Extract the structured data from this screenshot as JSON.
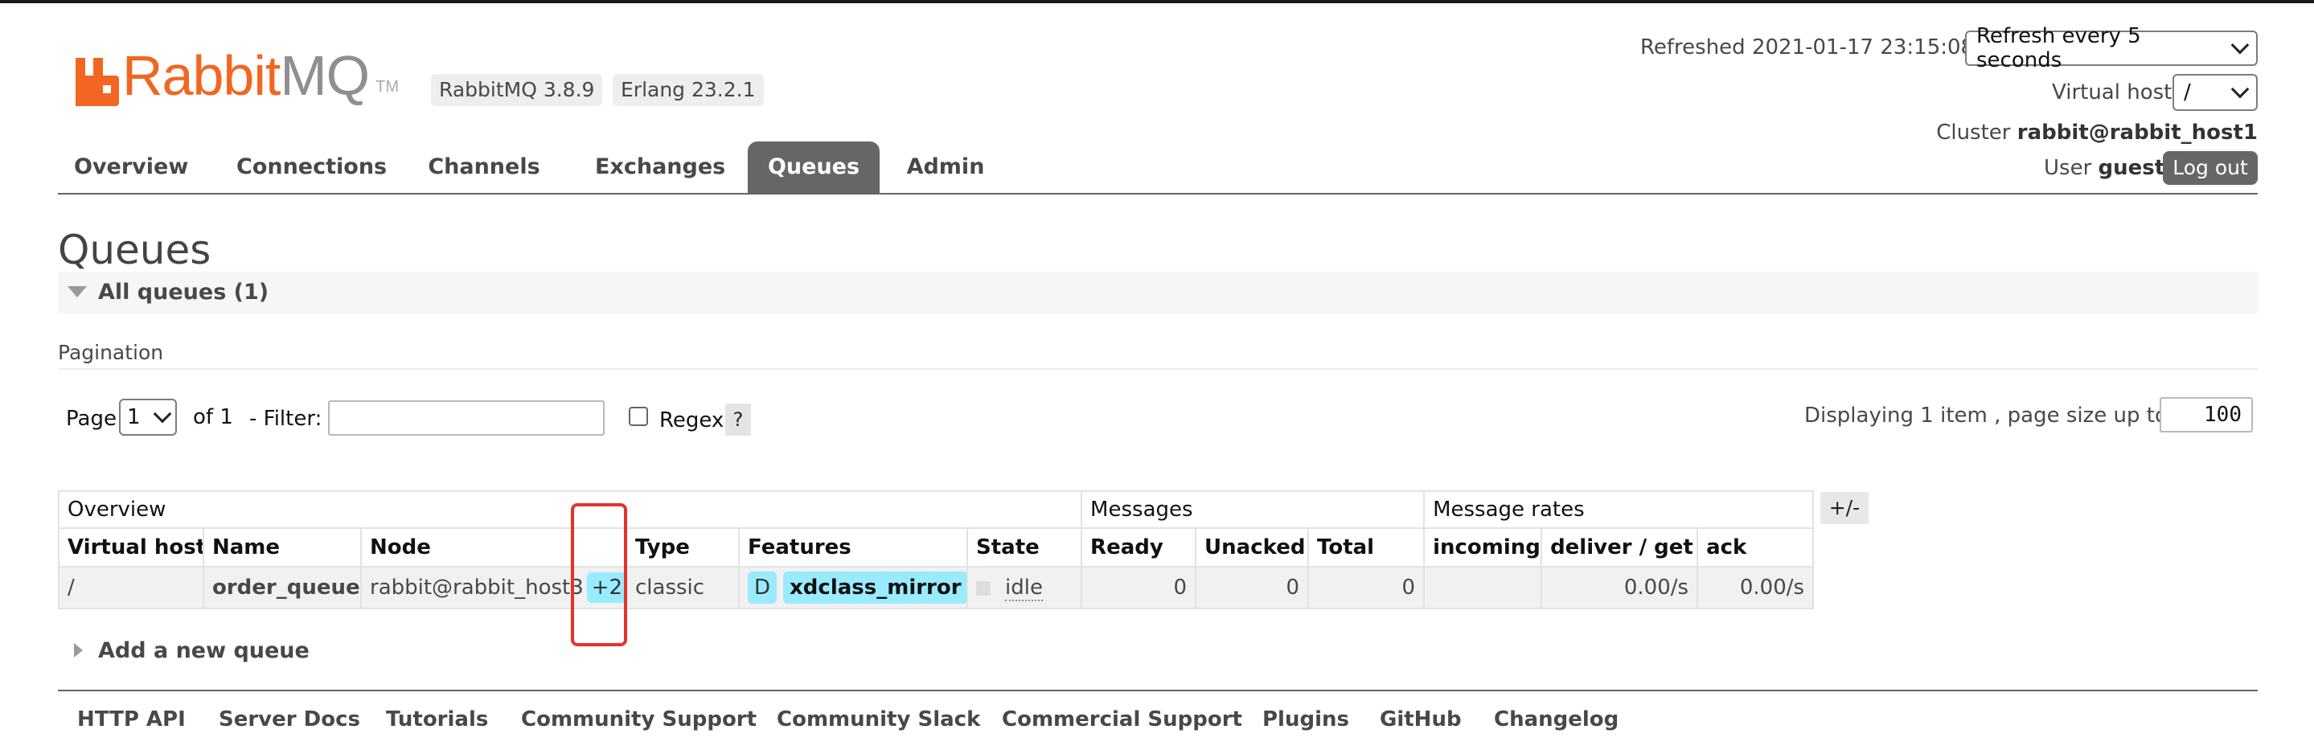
{
  "brand": {
    "rabbit": "Rabbit",
    "mq": "MQ",
    "tm": "TM"
  },
  "versions": {
    "rabbitmq": "RabbitMQ 3.8.9",
    "erlang": "Erlang 23.2.1"
  },
  "header": {
    "refreshed_label": "Refreshed 2021-01-17 23:15:08",
    "refresh_select": "Refresh every 5 seconds",
    "vhost_label": "Virtual host",
    "vhost_select": "/",
    "cluster_label": "Cluster",
    "cluster_name": "rabbit@rabbit_host1",
    "user_label": "User",
    "user_name": "guest",
    "logout": "Log out"
  },
  "nav": {
    "tabs": [
      {
        "label": "Overview"
      },
      {
        "label": "Connections"
      },
      {
        "label": "Channels"
      },
      {
        "label": "Exchanges"
      },
      {
        "label": "Queues",
        "active": true
      },
      {
        "label": "Admin"
      }
    ]
  },
  "main": {
    "title": "Queues",
    "section_title": "All queues (1)",
    "pagination_heading": "Pagination",
    "page_label": "Page",
    "page_value": "1",
    "of_label": "of 1",
    "filter_label": "- Filter:",
    "filter_value": "",
    "regex_label": "Regex",
    "regex_help": "?",
    "displaying_label": "Displaying 1 item , page size up to:",
    "page_size": "100",
    "columns_toggle": "+/-",
    "add_queue": "Add a new queue"
  },
  "table": {
    "groups": [
      "Overview",
      "Messages",
      "Message rates"
    ],
    "columns": [
      "Virtual host",
      "Name",
      "Node",
      "Type",
      "Features",
      "State",
      "Ready",
      "Unacked",
      "Total",
      "incoming",
      "deliver / get",
      "ack"
    ],
    "rows": [
      {
        "vhost": "/",
        "name": "order_queue",
        "node": "rabbit@rabbit_host3",
        "mirrors": "+2",
        "type": "classic",
        "feature_flag": "D",
        "feature_policy": "xdclass_mirror",
        "state": "idle",
        "ready": "0",
        "unacked": "0",
        "total": "0",
        "incoming": "",
        "deliver_get": "0.00/s",
        "ack": "0.00/s"
      }
    ]
  },
  "footer": {
    "links": [
      "HTTP API",
      "Server Docs",
      "Tutorials",
      "Community Support",
      "Community Slack",
      "Commercial Support",
      "Plugins",
      "GitHub",
      "Changelog"
    ]
  },
  "colors": {
    "brand_orange": "#f26621",
    "tab_active": "#666666",
    "badge_cyan": "#99ebff",
    "highlight_red": "#e8302a"
  }
}
